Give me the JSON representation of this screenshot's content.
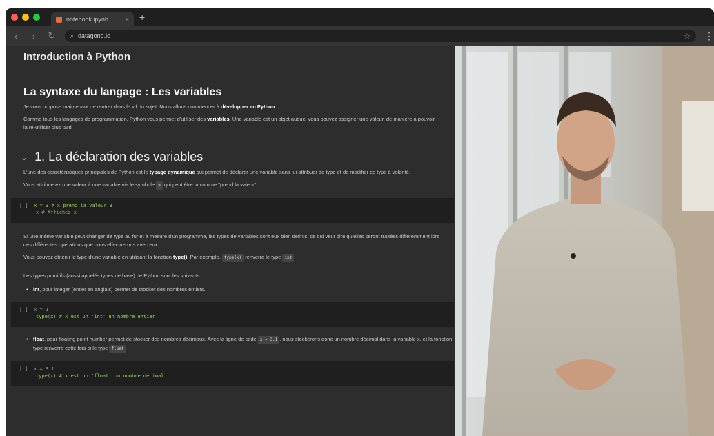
{
  "browser": {
    "tab_title": "notebook.ipynb",
    "tab_close": "×",
    "new_tab": "+",
    "url": "datagong.io",
    "back": "‹",
    "forward": "›",
    "reload": "↻",
    "search_glyph": "⌕",
    "star": "☆",
    "menu": "⋮"
  },
  "notebook": {
    "course_title": "Introduction à Python",
    "section_title": "La syntaxe du langage : Les variables",
    "intro_1_pre": "Je vous propose maintenant de rentrer dans le vif du sujet. Nous allons commencer à ",
    "intro_1_bold": "développer en Python",
    "intro_1_post": " !",
    "intro_2_pre": "Comme tous les langages de programmation, Python vous permet d'utiliser des ",
    "intro_2_bold": "variables",
    "intro_2_post": ". Une variable est un objet auquel vous pouvez assigner une valeur, de manière à pouvoir la ré-utiliser plus tard.",
    "subsection_chevron": "⌄",
    "subsection_title": "1. La déclaration des variables",
    "para_1_pre": "L'une des caractéristiques principales de Python est le ",
    "para_1_bold": "typage dynamique",
    "para_1_post": " qui permet de déclarer une variable sans lui attribuer de type et de modifier ce type à volonté.",
    "para_2_pre": "Vous attribuerez une valeur à une variable via le symbole ",
    "para_2_code": "=",
    "para_2_post": " qui peut être lu comme \"prend la valeur\".",
    "code_1_prompt": "[ ]",
    "code_1_line1": "x = 3  # x prend la valeur 3",
    "code_1_line2": "x  # Affichez x",
    "para_3": "Si une même variable peut changer de type au fur et à mesure d'un programme, les types de variables sont eux bien définis, ce qui veut dire qu'elles seront traitées différemment lors des différentes opérations que nous effectuerons avec eux.",
    "para_4_pre": "Vous pouvez obtenir le type d'une variable en utilisant la fonction ",
    "para_4_bold": "type()",
    "para_4_mid": ". Par exemple, ",
    "para_4_code1": "type(x)",
    "para_4_mid2": " renverra le type ",
    "para_4_code2": "int",
    "para_5": "Les types primitifs (aussi appelés types de base) de Python sont les suivants :",
    "bullet_1_bold": "int",
    "bullet_1_text": ", pour integer (entier en anglais) permet de stocker des nombres entiers.",
    "code_2_prompt": "[ ]",
    "code_2_line1": "x = 1",
    "code_2_line2": "type(x)  # x est un 'int' un nombre entier",
    "bullet_2_bold": "float",
    "bullet_2_text_pre": ", pour floating point number permet de stocker des nombres décimaux. Avec la ligne de code ",
    "bullet_2_code1": "x = 3.1",
    "bullet_2_text_mid": ", nous stockerons donc un nombre décimal dans la variable x, et la fonction type renverra cette fois-ci le type ",
    "bullet_2_code2": "float",
    "code_3_prompt": "[ ]",
    "code_3_line1": "x = 3.1",
    "code_3_line2": "type(x)  # x est un 'float' un nombre décimal"
  },
  "colors": {
    "background": "#2d2d2d",
    "code_bg": "#1f1f1f",
    "comment_green": "#9ccc65"
  }
}
